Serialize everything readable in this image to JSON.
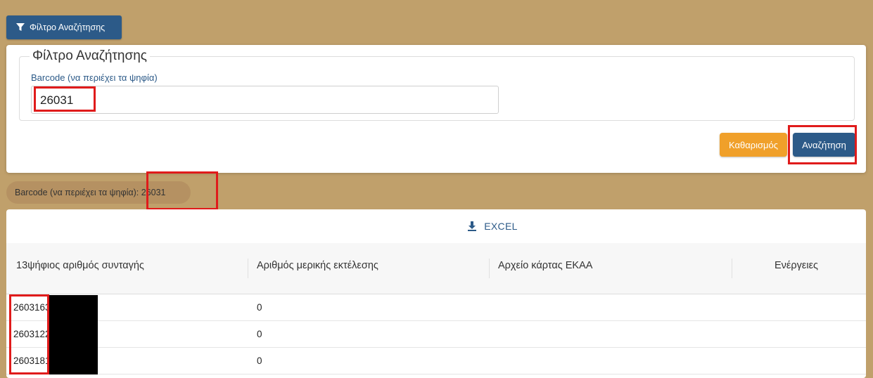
{
  "filter_toggle": {
    "label": "Φίλτρο Αναζήτησης"
  },
  "filter_panel": {
    "legend": "Φίλτρο Αναζήτησης",
    "barcode_label": "Barcode (να περιέχει τα ψηφία)",
    "barcode_value": "26031",
    "clear_label": "Καθαρισμός",
    "search_label": "Αναζήτηση"
  },
  "active_filter_chip": "Barcode (να περιέχει τα ψηφία): 26031",
  "results": {
    "excel_label": "EXCEL",
    "columns": [
      "13ψήφιος αριθμός συνταγής",
      "Αριθμός μερικής εκτέλεσης",
      "Αρχείο κάρτας ΕΚΑΑ",
      "Ενέργειες"
    ],
    "rows": [
      {
        "prescription": "2603163",
        "partial": "0"
      },
      {
        "prescription": "2603122",
        "partial": "0"
      },
      {
        "prescription": "2603181",
        "partial": "0"
      }
    ]
  },
  "colors": {
    "background": "#c0a06b",
    "primary": "#2c5a88",
    "warning": "#f0a02a",
    "highlight": "#e01b1b"
  }
}
